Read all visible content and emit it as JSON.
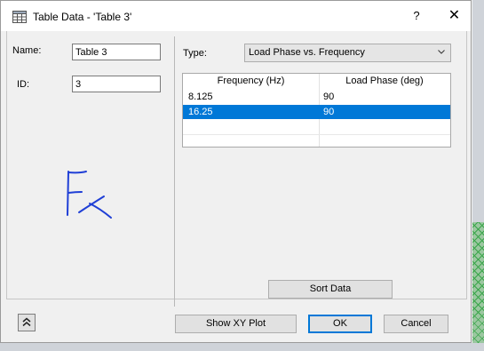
{
  "window": {
    "title": "Table Data - 'Table 3'",
    "help_glyph": "?",
    "close_glyph": "✕"
  },
  "left_panel": {
    "name_label": "Name:",
    "name_value": "Table 3",
    "id_label": "ID:",
    "id_value": "3"
  },
  "right_panel": {
    "type_label": "Type:",
    "type_value": "Load Phase vs. Frequency",
    "table": {
      "columns": [
        "Frequency (Hz)",
        "Load Phase (deg)"
      ],
      "rows": [
        [
          "8.125",
          "90"
        ],
        [
          "16.25",
          "90"
        ]
      ],
      "selected_row": 1
    },
    "sort_button": "Sort Data"
  },
  "footer": {
    "show_xy_plot": "Show XY Plot",
    "ok": "OK",
    "cancel": "Cancel"
  },
  "colors": {
    "selection": "#0078d7",
    "sketch_ink": "#1f3fd6"
  },
  "icons": [
    "table-icon",
    "help-icon",
    "close-icon",
    "chevron-down-icon",
    "double-chevron-up-icon"
  ]
}
